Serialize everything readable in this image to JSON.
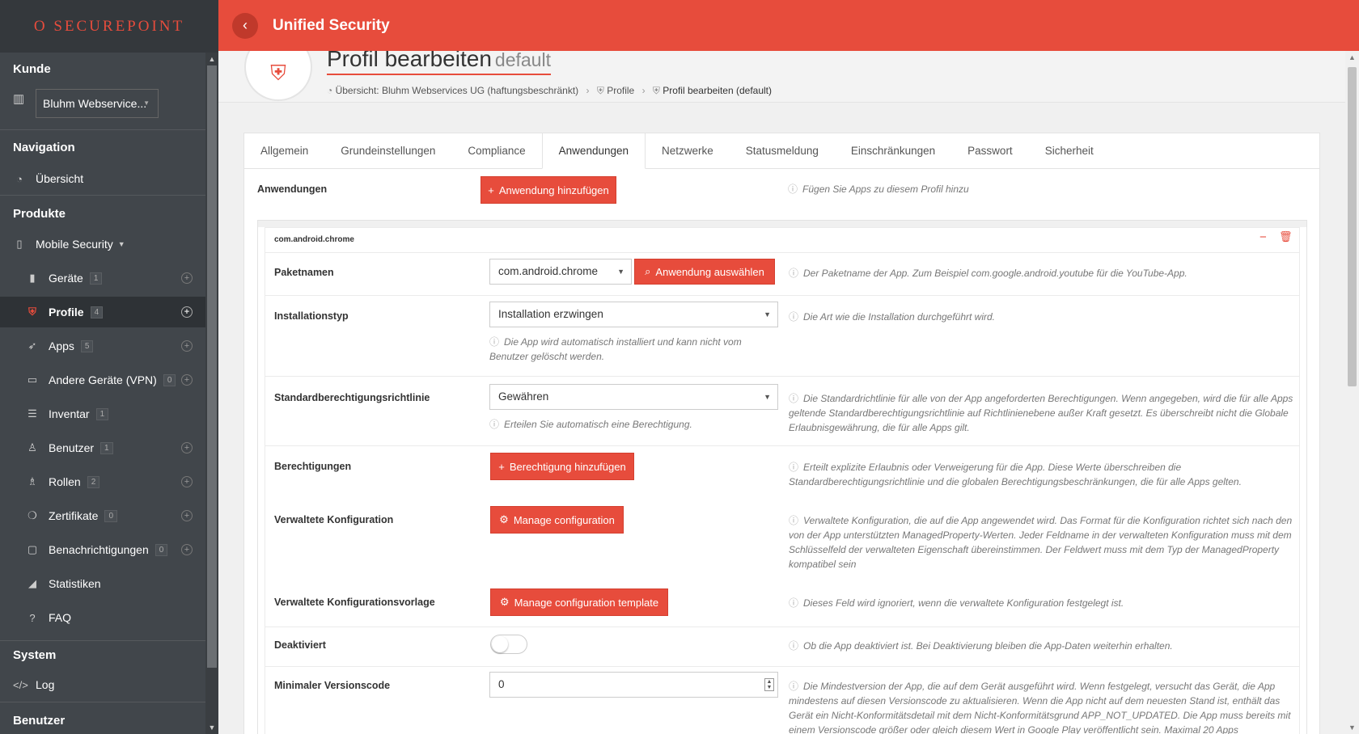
{
  "brand": {
    "logo_text": "O SECUREPOINT"
  },
  "topbar": {
    "back_icon": "chevron-left-icon",
    "title": "Unified Security"
  },
  "sidebar": {
    "customer_heading": "Kunde",
    "customer_select": "Bluhm Webservice...",
    "nav_heading": "Navigation",
    "overview": "Übersicht",
    "products_heading": "Produkte",
    "mobile_security": "Mobile Security",
    "items": [
      {
        "label": "Geräte",
        "count": "1",
        "icon": "phone-icon"
      },
      {
        "label": "Profile",
        "count": "4",
        "icon": "shield-icon"
      },
      {
        "label": "Apps",
        "count": "5",
        "icon": "rocket-icon"
      },
      {
        "label": "Andere Geräte (VPN)",
        "count": "0",
        "icon": "laptop-icon"
      },
      {
        "label": "Inventar",
        "count": "1",
        "icon": "list-icon"
      },
      {
        "label": "Benutzer",
        "count": "1",
        "icon": "user-icon"
      },
      {
        "label": "Rollen",
        "count": "2",
        "icon": "users-icon"
      },
      {
        "label": "Zertifikate",
        "count": "0",
        "icon": "certificate-icon"
      },
      {
        "label": "Benachrichtigungen",
        "count": "0",
        "icon": "message-icon"
      },
      {
        "label": "Statistiken",
        "icon": "chart-icon"
      },
      {
        "label": "FAQ",
        "icon": "help-icon"
      }
    ],
    "system_heading": "System",
    "log": "Log",
    "users_heading": "Benutzer"
  },
  "page": {
    "title": "Profil bearbeiten",
    "subtitle": "default",
    "breadcrumb": [
      "Übersicht: Bluhm Webservices UG (haftungsbeschränkt)",
      "Profile",
      "Profil bearbeiten (default)"
    ]
  },
  "tabs": [
    "Allgemein",
    "Grundeinstellungen",
    "Compliance",
    "Anwendungen",
    "Netzwerke",
    "Statusmeldung",
    "Einschränkungen",
    "Passwort",
    "Sicherheit"
  ],
  "form": {
    "apps_label": "Anwendungen",
    "add_app_button": "Anwendung hinzufügen",
    "add_app_hint": "Fügen Sie Apps zu diesem Profil hinzu",
    "app_package_title": "com.android.chrome",
    "package_label": "Paketnamen",
    "package_value": "com.android.chrome",
    "select_app_button": "Anwendung auswählen",
    "package_hint": "Der Paketname der App. Zum Beispiel com.google.android.youtube für die YouTube-App.",
    "install_label": "Installationstyp",
    "install_value": "Installation erzwingen",
    "install_sub_hint": "Die App wird automatisch installiert und kann nicht vom Benutzer gelöscht werden.",
    "install_hint": "Die Art wie die Installation durchgeführt wird.",
    "perm_policy_label": "Standardberechtigungsrichtlinie",
    "perm_policy_value": "Gewähren",
    "perm_policy_sub_hint": "Erteilen Sie automatisch eine Berechtigung.",
    "perm_policy_hint": "Die Standardrichtlinie für alle von der App angeforderten Berechtigungen. Wenn angegeben, wird die für alle Apps geltende Standardberechtigungsrichtlinie auf Richtlinienebene außer Kraft gesetzt. Es überschreibt nicht die Globale Erlaubnisgewährung, die für alle Apps gilt.",
    "permissions_label": "Berechtigungen",
    "add_permission_button": "Berechtigung hinzufügen",
    "permissions_hint": "Erteilt explizite Erlaubnis oder Verweigerung für die App. Diese Werte überschreiben die Standardberechtigungsrichtlinie und die globalen Berechtigungsbeschränkungen, die für alle Apps gelten.",
    "managed_config_label": "Verwaltete Konfiguration",
    "managed_config_button": "Manage configuration",
    "managed_config_hint": "Verwaltete Konfiguration, die auf die App angewendet wird. Das Format für die Konfiguration richtet sich nach den von der App unterstützten ManagedProperty-Werten. Jeder Feldname in der verwalteten Konfiguration muss mit dem Schlüsselfeld der verwalteten Eigenschaft übereinstimmen. Der Feldwert muss mit dem Typ der ManagedProperty kompatibel sein",
    "managed_tpl_label": "Verwaltete Konfigurationsvorlage",
    "managed_tpl_button": "Manage configuration template",
    "managed_tpl_hint": "Dieses Feld wird ignoriert, wenn die verwaltete Konfiguration festgelegt ist.",
    "disabled_label": "Deaktiviert",
    "disabled_value": false,
    "disabled_hint": "Ob die App deaktiviert ist. Bei Deaktivierung bleiben die App-Daten weiterhin erhalten.",
    "min_version_label": "Minimaler Versionscode",
    "min_version_value": "0",
    "min_version_hint": "Die Mindestversion der App, die auf dem Gerät ausgeführt wird. Wenn festgelegt, versucht das Gerät, die App mindestens auf diesen Versionscode zu aktualisieren. Wenn die App nicht auf dem neuesten Stand ist, enthält das Gerät ein Nicht-Konformitätsdetail mit dem Nicht-Konformitätsgrund APP_NOT_UPDATED. Die App muss bereits mit einem Versionscode größer oder gleich diesem Wert in Google Play veröffentlicht sein. Maximal 20 Apps"
  },
  "colors": {
    "accent": "#e74c3c",
    "sidebar": "#41464b"
  }
}
